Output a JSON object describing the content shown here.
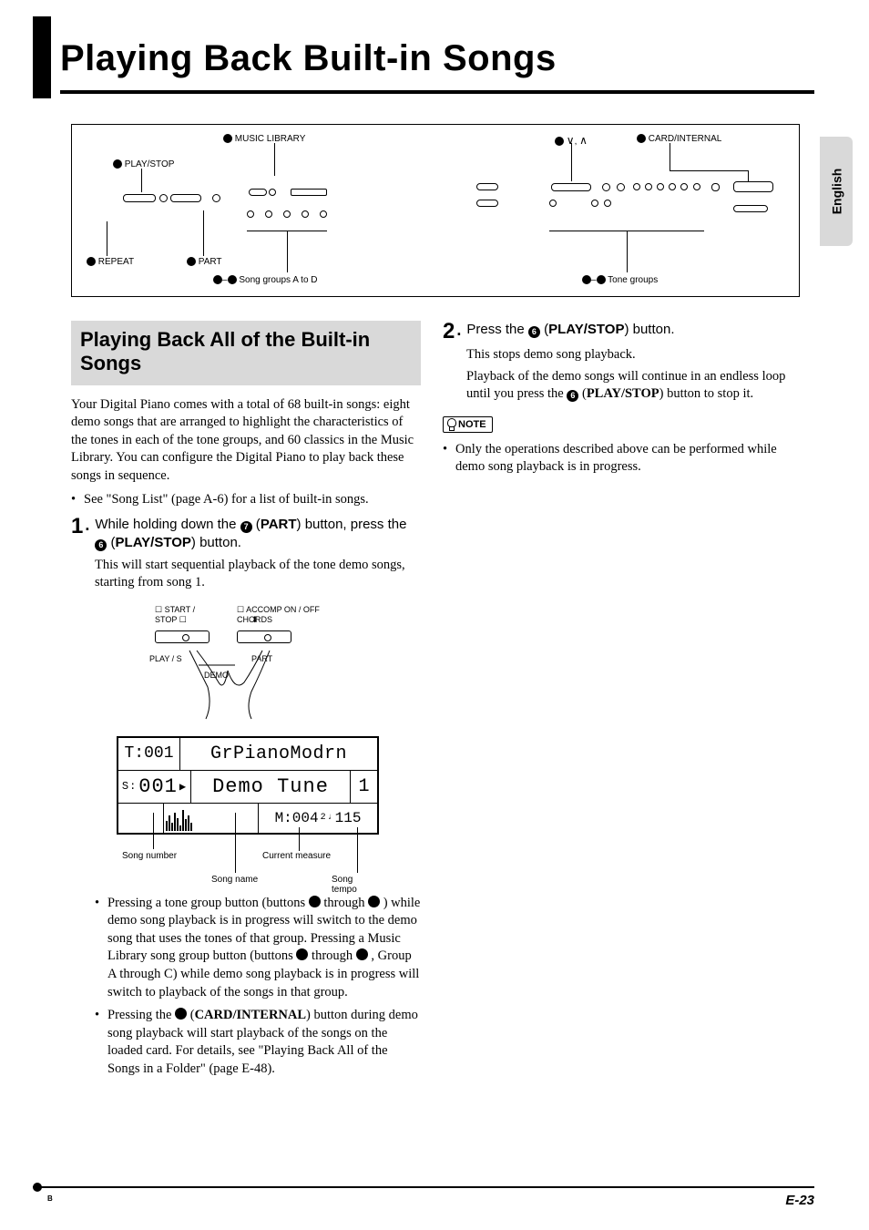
{
  "chapter_title": "Playing Back Built-in Songs",
  "side_tab": "English",
  "diagram": {
    "labels": {
      "music_library": {
        "num": "bl",
        "text": "MUSIC LIBRARY"
      },
      "play_stop": {
        "num": "6",
        "text": "PLAY/STOP"
      },
      "repeat": {
        "num": "2",
        "text": "REPEAT"
      },
      "part": {
        "num": "7",
        "text": "PART"
      },
      "song_groups": {
        "range": "bm–bp",
        "text": "Song groups A to D"
      },
      "down_up": {
        "num": "br",
        "text": ",  "
      },
      "card_internal": {
        "num": "bt",
        "text": "CARD/INTERNAL"
      },
      "tone_groups": {
        "range": "ck–cr",
        "text": "Tone groups"
      }
    }
  },
  "section_title": "Playing Back All of the Built-in Songs",
  "intro_para": "Your Digital Piano comes with a total of 68 built-in songs: eight demo songs that are arranged to highlight the characteristics of the tones in each of the tone groups, and 60 classics in the Music Library. You can configure the Digital Piano to play back these songs in sequence.",
  "intro_bullet": "See \"Song List\" (page A-6) for a list of built-in songs.",
  "step1": {
    "num": "1",
    "line": "While holding down the ",
    "btn_a_num": "7",
    "btn_a_label": "PART",
    "mid": ") button, press the ",
    "btn_b_num": "6",
    "btn_b_label": "PLAY/STOP",
    "tail": ") button.",
    "sub": "This will start sequential playback of the tone demo songs, starting from song 1."
  },
  "hand": {
    "start_stop": "START / \nSTOP",
    "accomp": "ACCOMP ON / OFF\nCHORDS",
    "play_s": "PLAY / S",
    "part": "PART",
    "demo": "DEMO"
  },
  "lcd": {
    "tone_num": "T:001",
    "tone_name": "GrPianoModrn",
    "song_num": "S:001",
    "song_play_icon": "▶",
    "song_name": "Demo Tune",
    "song_idx": "1",
    "measure": "M:004",
    "beat": "2",
    "tempo": "115",
    "lbl_song_number": "Song number",
    "lbl_current_measure": "Current measure",
    "lbl_song_name": "Song name",
    "lbl_song_tempo": "Song tempo"
  },
  "post_lcd_bullets": {
    "b1_a": "Pressing a tone group button (buttons ",
    "b1_n1": "ck",
    "b1_b": " through ",
    "b1_n2": "cr",
    "b1_c": ") while demo song playback is in progress will switch to the demo song that uses the tones of that group. Pressing a Music Library song group button (buttons ",
    "b1_n3": "bm",
    "b1_d": " through ",
    "b1_n4": "bo",
    "b1_e": ", Group A through C) while demo song playback is in progress will switch to playback of the songs in that group.",
    "b2_a": "Pressing the ",
    "b2_n": "bt",
    "b2_b": " (",
    "b2_label": "CARD/INTERNAL",
    "b2_c": ") button during demo song playback will start playback of the songs on the loaded card. For details, see \"Playing Back All of the Songs in a Folder\" (page E-48)."
  },
  "step2": {
    "num": "2",
    "line": "Press the ",
    "btn_num": "6",
    "btn_label": "PLAY/STOP",
    "tail": ") button.",
    "sub1": "This stops demo song playback.",
    "sub2a": "Playback of the demo songs will continue in an endless loop until you press the ",
    "sub2_num": "6",
    "sub2_lbl": "PLAY/STOP",
    "sub2b": ") button to stop it."
  },
  "note": {
    "badge": "NOTE",
    "text": "Only the operations described above can be performed while demo song playback is in progress."
  },
  "footer": {
    "page": "E-23",
    "b": "B"
  }
}
